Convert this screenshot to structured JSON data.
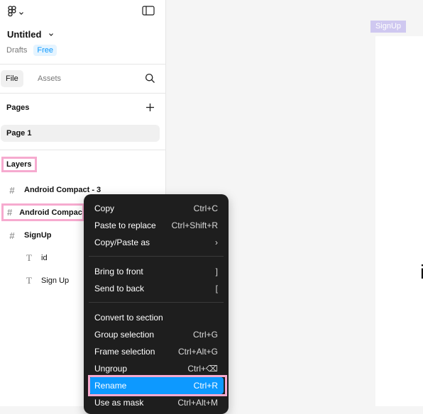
{
  "colors": {
    "accent": "#0d99ff",
    "highlight": "#f6aacf",
    "menu_bg": "#1e1e1e",
    "frame_label_bg": "#cfc8f0"
  },
  "file": {
    "title": "Untitled",
    "location": "Drafts",
    "plan_badge": "Free"
  },
  "tabs": [
    {
      "label": "File",
      "active": true
    },
    {
      "label": "Assets",
      "active": false
    }
  ],
  "pages": {
    "title": "Pages",
    "items": [
      "Page 1"
    ]
  },
  "layers": {
    "title": "Layers",
    "items": [
      {
        "label": "Android Compact - 3",
        "icon": "frame-icon"
      },
      {
        "label": "Android Compact",
        "icon": "frame-icon"
      },
      {
        "label": "SignUp",
        "icon": "frame-icon"
      },
      {
        "label": "id",
        "icon": "text-icon"
      },
      {
        "label": "Sign Up",
        "icon": "text-icon"
      }
    ]
  },
  "canvas": {
    "frame_label": "SignUp",
    "glyph": "i"
  },
  "context_menu": {
    "items": [
      {
        "label": "Copy",
        "shortcut": "Ctrl+C"
      },
      {
        "label": "Paste to replace",
        "shortcut": "Ctrl+Shift+R"
      },
      {
        "label": "Copy/Paste as",
        "shortcut": "›"
      },
      {
        "label": "Bring to front",
        "shortcut": "]"
      },
      {
        "label": "Send to back",
        "shortcut": "["
      },
      {
        "label": "Convert to section",
        "shortcut": ""
      },
      {
        "label": "Group selection",
        "shortcut": "Ctrl+G"
      },
      {
        "label": "Frame selection",
        "shortcut": "Ctrl+Alt+G"
      },
      {
        "label": "Ungroup",
        "shortcut": "Ctrl+⌫"
      },
      {
        "label": "Rename",
        "shortcut": "Ctrl+R"
      },
      {
        "label": "Use as mask",
        "shortcut": "Ctrl+Alt+M"
      }
    ]
  }
}
